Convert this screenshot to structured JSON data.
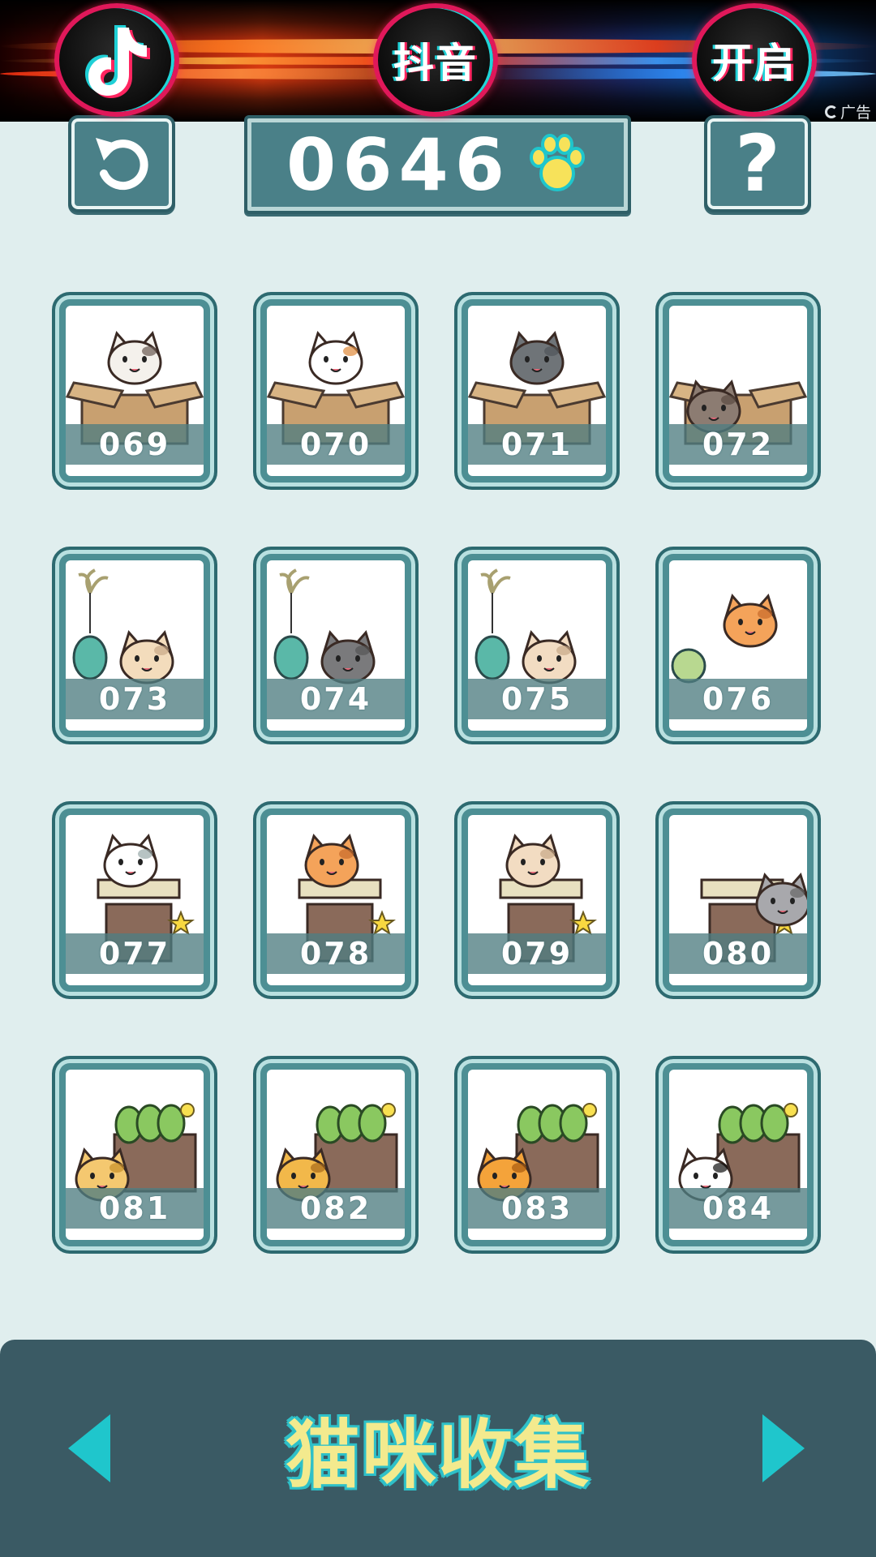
{
  "ad": {
    "circle_1_icon": "tiktok-note-icon",
    "circle_2_text": "抖音",
    "circle_3_text": "开启",
    "label": "广告"
  },
  "header": {
    "back_icon": "undo-arrow-icon",
    "score": "0646",
    "score_icon": "paw-icon",
    "help_label": "?"
  },
  "collection": {
    "cards": [
      {
        "number": "069",
        "art": "calico-cat-in-box"
      },
      {
        "number": "070",
        "art": "orange-white-cat-in-box"
      },
      {
        "number": "071",
        "art": "gray-cat-in-box"
      },
      {
        "number": "072",
        "art": "tabby-cat-under-box"
      },
      {
        "number": "073",
        "art": "cream-cat-with-egg-toy"
      },
      {
        "number": "074",
        "art": "gray-cat-with-egg-toy"
      },
      {
        "number": "075",
        "art": "beige-cat-with-egg-toy"
      },
      {
        "number": "076",
        "art": "orange-cat-eating"
      },
      {
        "number": "077",
        "art": "white-cat-on-scratcher"
      },
      {
        "number": "078",
        "art": "orange-cat-on-scratcher"
      },
      {
        "number": "079",
        "art": "beige-cat-on-scratcher"
      },
      {
        "number": "080",
        "art": "gray-cat-beside-scratcher"
      },
      {
        "number": "081",
        "art": "lion-by-vegetable-crate"
      },
      {
        "number": "082",
        "art": "leopard-by-vegetable-crate"
      },
      {
        "number": "083",
        "art": "tiger-by-vegetable-crate"
      },
      {
        "number": "084",
        "art": "panda-by-vegetable-crate"
      }
    ]
  },
  "footer": {
    "title": "猫咪收集",
    "prev_icon": "triangle-left-icon",
    "next_icon": "triangle-right-icon"
  },
  "colors": {
    "background": "#e0eeee",
    "button_teal": "#4a8088",
    "panel_dark": "#3a5a64",
    "arrow_cyan": "#1fc6cc",
    "title_yellow": "#f3ea8e"
  }
}
